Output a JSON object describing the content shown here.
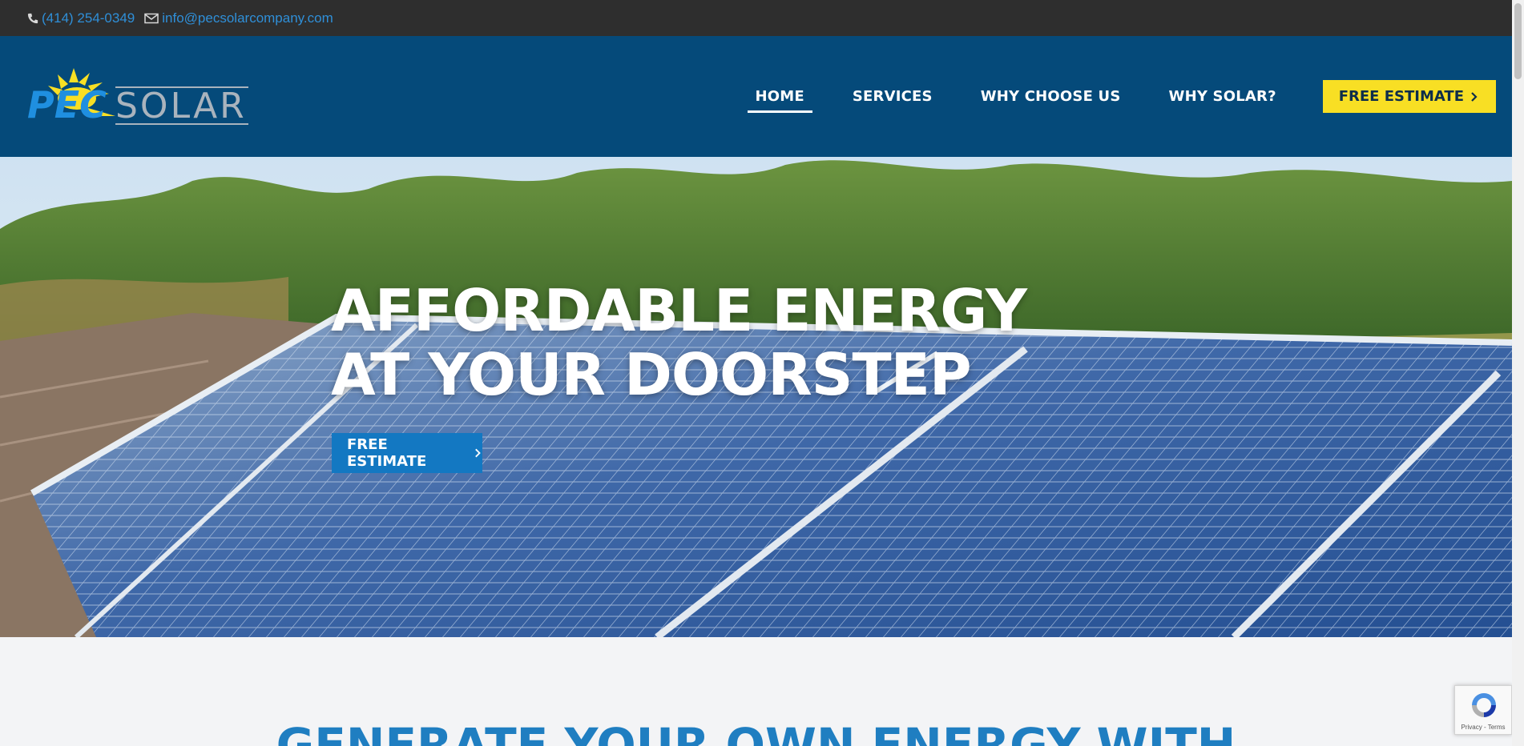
{
  "topbar": {
    "phone": "(414) 254-0349",
    "email": "info@pecsolarcompany.com",
    "phone_icon": "phone-icon",
    "email_icon": "envelope-icon"
  },
  "header": {
    "logo": {
      "pec": "PEC",
      "solar": "SOLAR"
    },
    "nav": [
      {
        "label": "HOME",
        "active": true
      },
      {
        "label": "SERVICES"
      },
      {
        "label": "WHY CHOOSE US"
      },
      {
        "label": "WHY SOLAR?"
      }
    ],
    "cta_label": "FREE ESTIMATE",
    "cta_icon": "chevron-right-icon"
  },
  "hero": {
    "title_line1": "AFFORDABLE ENERGY",
    "title_line2": "AT YOUR DOORSTEP",
    "button_label": "FREE ESTIMATE",
    "button_icon": "chevron-right-icon"
  },
  "section": {
    "title": "GENERATE YOUR OWN ENERGY WITH"
  },
  "recaptcha": {
    "links": "Privacy - Terms"
  },
  "colors": {
    "topbar": "#2e2e2e",
    "header": "#054a7a",
    "link": "#2f8fd8",
    "cta_yellow": "#f8df24",
    "hero_button": "#1378c2",
    "section_title": "#1f7ec1"
  }
}
